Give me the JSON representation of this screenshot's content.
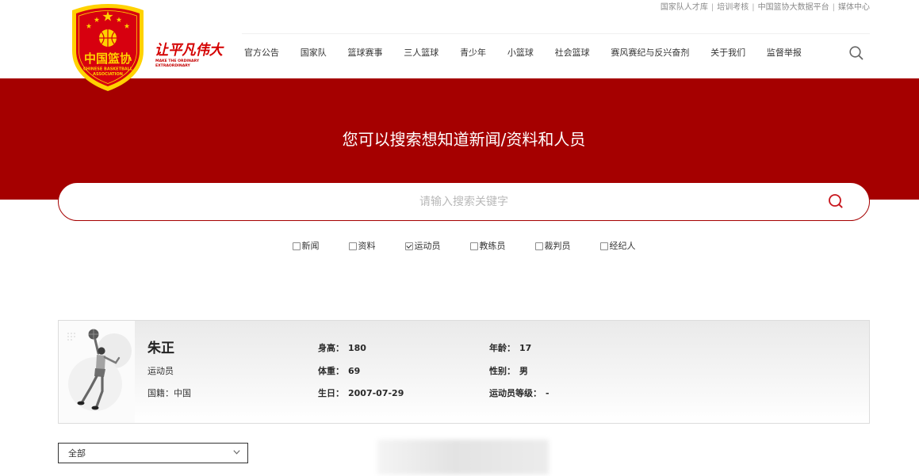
{
  "colors": {
    "brand_red": "#a50000",
    "logo_red": "#d7000f",
    "logo_yellow": "#ffd200",
    "text_primary": "#333333",
    "text_muted": "#8a8a8a",
    "placeholder": "#b9b9b9"
  },
  "top_links": {
    "separator": "|",
    "items": [
      {
        "label": "国家队人才库"
      },
      {
        "label": "培训考核"
      },
      {
        "label": "中国篮协大数据平台"
      },
      {
        "label": "媒体中心"
      }
    ]
  },
  "logo": {
    "icon": "cba-shield-logo",
    "cn_text": "中国篮协",
    "en_line1": "CHINESE BASKETBALL",
    "en_line2": "ASSOCIATION"
  },
  "slogan": {
    "cn": "让平凡伟大",
    "en_line1": "MAKE THE ORDINARY",
    "en_line2": "EXTRAORDINARY"
  },
  "nav": {
    "items": [
      {
        "label": "官方公告"
      },
      {
        "label": "国家队"
      },
      {
        "label": "篮球赛事"
      },
      {
        "label": "三人篮球"
      },
      {
        "label": "青少年"
      },
      {
        "label": "小篮球"
      },
      {
        "label": "社会篮球"
      },
      {
        "label": "赛风赛纪与反兴奋剂"
      },
      {
        "label": "关于我们"
      },
      {
        "label": "监督举报"
      }
    ],
    "search_icon": "search-icon"
  },
  "hero": {
    "title": "您可以搜索想知道新闻/资料和人员"
  },
  "search": {
    "placeholder": "请输入搜索关键字",
    "value": "",
    "submit_icon": "search-icon"
  },
  "filters": [
    {
      "label": "新闻",
      "checked": false
    },
    {
      "label": "资料",
      "checked": false
    },
    {
      "label": "运动员",
      "checked": true
    },
    {
      "label": "教练员",
      "checked": false
    },
    {
      "label": "裁判员",
      "checked": false
    },
    {
      "label": "经纪人",
      "checked": false
    }
  ],
  "athlete": {
    "photo_icon": "basketball-player-icon",
    "name": "朱正",
    "role": "运动员",
    "nationality": {
      "label": "国籍：",
      "value": "中国"
    },
    "height": {
      "label": "身高：",
      "value": "180"
    },
    "weight": {
      "label": "体重：",
      "value": "69"
    },
    "birthday": {
      "label": "生日：",
      "value": "2007-07-29"
    },
    "age": {
      "label": "年龄：",
      "value": "17"
    },
    "gender": {
      "label": "性别：",
      "value": "男"
    },
    "level": {
      "label": "运动员等级：",
      "value": "-"
    }
  },
  "result_filter": {
    "selected": "全部",
    "icon": "chevron-down-icon"
  }
}
